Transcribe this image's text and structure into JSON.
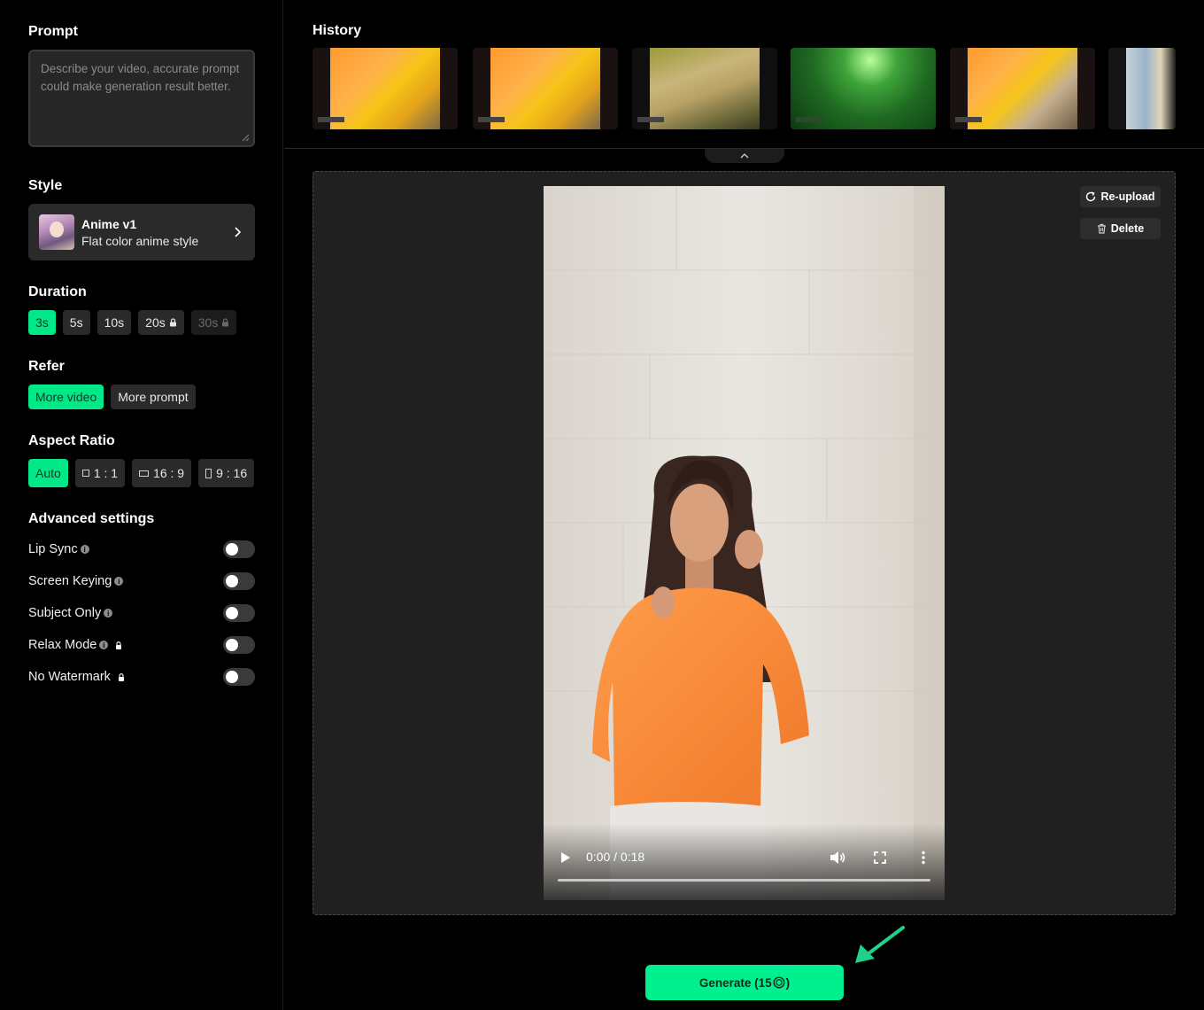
{
  "sidebar": {
    "prompt": {
      "title": "Prompt",
      "placeholder": "Describe your video, accurate prompt could make generation result better."
    },
    "style": {
      "title": "Style",
      "name": "Anime v1",
      "description": "Flat color anime style"
    },
    "duration": {
      "title": "Duration",
      "options": [
        {
          "label": "3s",
          "state": "active"
        },
        {
          "label": "5s",
          "state": "normal"
        },
        {
          "label": "10s",
          "state": "normal"
        },
        {
          "label": "20s",
          "state": "locked"
        },
        {
          "label": "30s",
          "state": "disabled-locked"
        }
      ]
    },
    "refer": {
      "title": "Refer",
      "options": [
        {
          "label": "More video",
          "state": "active"
        },
        {
          "label": "More prompt",
          "state": "normal"
        }
      ]
    },
    "aspect_ratio": {
      "title": "Aspect Ratio",
      "options": [
        {
          "label": "Auto",
          "state": "active"
        },
        {
          "label": "1 : 1",
          "state": "normal"
        },
        {
          "label": "16 : 9",
          "state": "normal"
        },
        {
          "label": "9 : 16",
          "state": "normal"
        }
      ]
    },
    "advanced": {
      "title": "Advanced settings",
      "items": [
        {
          "label": "Lip Sync",
          "info": true,
          "locked": false,
          "on": false
        },
        {
          "label": "Screen Keying",
          "info": true,
          "locked": false,
          "on": false
        },
        {
          "label": "Subject Only",
          "info": true,
          "locked": false,
          "on": false
        },
        {
          "label": "Relax Mode",
          "info": true,
          "locked": true,
          "on": false
        },
        {
          "label": "No Watermark",
          "info": false,
          "locked": true,
          "on": false
        }
      ]
    }
  },
  "history": {
    "title": "History",
    "items": [
      "yellow-plane-scene",
      "yellow-plane-scene",
      "desert-plane-scene",
      "green-night-plane-scene",
      "yellow-portrait-scene",
      "map-scene"
    ]
  },
  "video": {
    "time": "0:00 / 0:18",
    "progress": 0
  },
  "actions": {
    "reupload": "Re-upload",
    "delete": "Delete",
    "generate": "Generate (15"
  },
  "colors": {
    "accent": "#00f08f",
    "panel": "#202020",
    "chip": "#2a2a2a"
  }
}
